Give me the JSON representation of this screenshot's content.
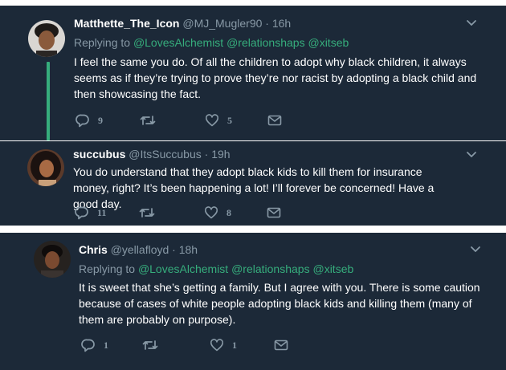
{
  "tweets": [
    {
      "name": "Matthette_The_Icon",
      "handle": "@MJ_Mugler90",
      "separator": "·",
      "time": "16h",
      "replying_prefix": "Replying to",
      "mentions": [
        "@LovesAlchemist",
        "@relationshaps",
        "@xitseb"
      ],
      "text": "I feel the same you do. Of all the children to adopt why black children, it always seems as if they’re trying to prove they’re nor racist by adopting a black child and then showcasing the fact.",
      "reply_count": "9",
      "retweet_count": "",
      "like_count": "5"
    },
    {
      "name": "succubus",
      "handle": "@ItsSuccubus",
      "separator": "·",
      "time": "19h",
      "replying_prefix": "",
      "mentions": [],
      "text": "You do understand that they adopt black kids to kill them for insurance money, right? It’s been happening a lot! I’ll forever be concerned! Have a good day.",
      "reply_count": "11",
      "retweet_count": "",
      "like_count": "8"
    },
    {
      "name": "Chris",
      "handle": "@yellafloyd",
      "separator": "·",
      "time": "18h",
      "replying_prefix": "Replying to",
      "mentions": [
        "@LovesAlchemist",
        "@relationshaps",
        "@xitseb"
      ],
      "text": "It is sweet that she’s getting a family. But I agree with you. There is some caution because of cases of white people adopting black kids and killing them (many of them are probably on purpose).",
      "reply_count": "1",
      "retweet_count": "",
      "like_count": "1"
    }
  ],
  "icons": {
    "reply": "reply-icon",
    "retweet": "retweet-icon",
    "like": "like-icon",
    "dm": "direct-message-icon",
    "caret": "chevron-down-icon"
  },
  "colors": {
    "background": "#1c2938",
    "text": "#ffffff",
    "muted": "#8899a6",
    "accent": "#36ad7c"
  }
}
